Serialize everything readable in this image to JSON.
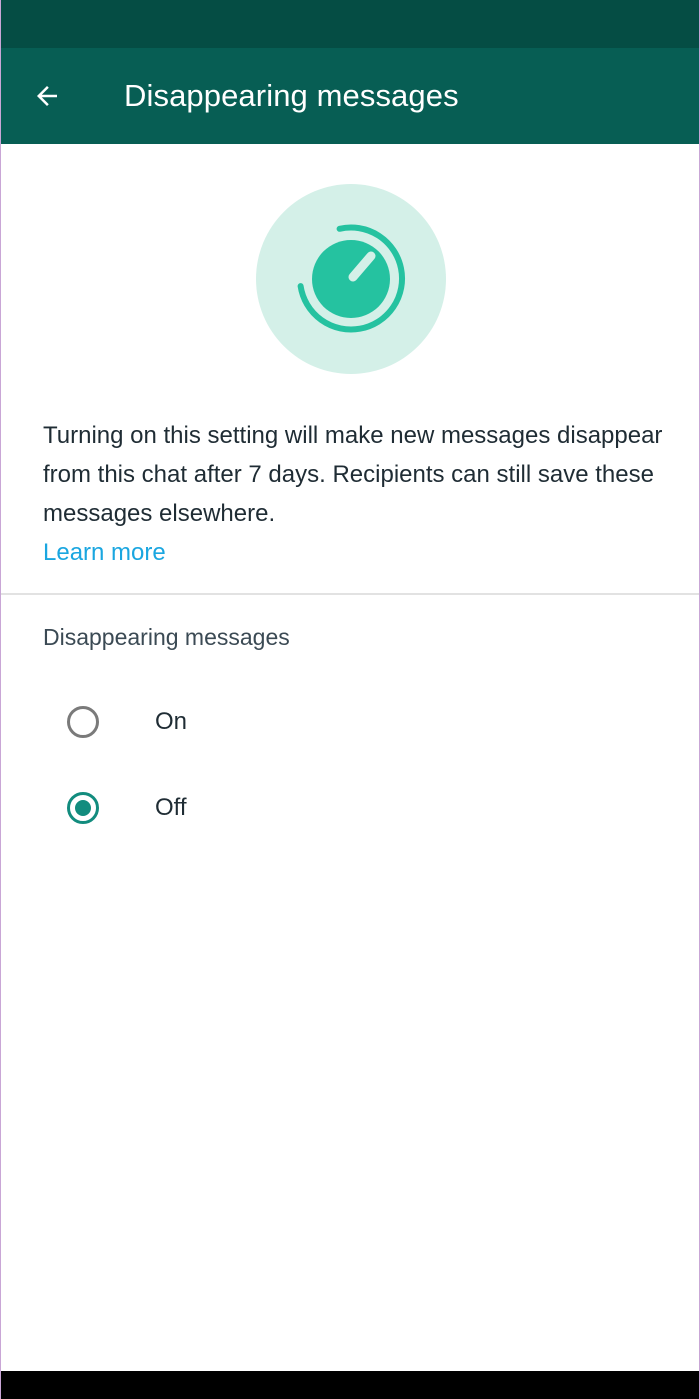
{
  "app_bar": {
    "title": "Disappearing messages",
    "back_icon": "arrow-left-icon"
  },
  "hero": {
    "icon": "timer-icon"
  },
  "description": {
    "text": "Turning on this setting will make new messages disappear from this chat after 7 days. Recipients can still save these messages elsewhere.",
    "link": "Learn more"
  },
  "setting": {
    "title": "Disappearing messages",
    "options": [
      {
        "label": "On",
        "selected": false
      },
      {
        "label": "Off",
        "selected": true
      }
    ]
  },
  "colors": {
    "header": "#075e54",
    "status_bar": "#054d44",
    "accent": "#128c7e",
    "link": "#1aa6e0",
    "hero_bg": "#d4f0e8",
    "hero_icon": "#25c2a0"
  }
}
